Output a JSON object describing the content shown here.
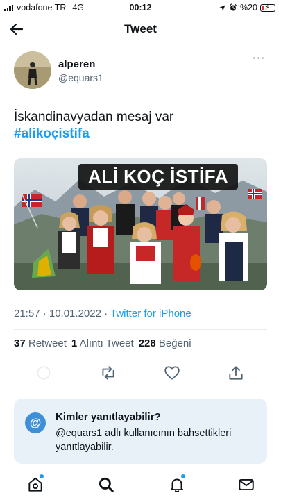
{
  "status_bar": {
    "carrier": "vodafone TR",
    "network": "4G",
    "time": "00:12",
    "battery_percent": "%20",
    "battery_level": 0.2
  },
  "header": {
    "title": "Tweet"
  },
  "tweet": {
    "user_name": "alperen",
    "user_handle": "@equars1",
    "text": "İskandinavyadan mesaj var",
    "hashtag": "#alikoçistifa",
    "media_caption": "ALİ KOÇ İSTİFA",
    "time": "21:57 · 10.01.2022 ·",
    "source": "Twitter for iPhone"
  },
  "stats": {
    "retweets_count": "37",
    "retweets_label": "Retweet",
    "quotes_count": "1",
    "quotes_label": "Alıntı Tweet",
    "likes_count": "228",
    "likes_label": "Beğeni"
  },
  "reply_info": {
    "icon_glyph": "@",
    "title": "Kimler yanıtlayabilir?",
    "description": "@equars1 adlı kullanıcının bahsettikleri yanıtlayabilir."
  },
  "colors": {
    "accent": "#1d9bf0",
    "secondary_text": "#536471",
    "card_background": "#e8f1f8"
  },
  "icons": {
    "back": "arrow-left-icon",
    "more": "more-icon",
    "reply": "reply-icon",
    "retweet": "retweet-icon",
    "like": "heart-icon",
    "share": "share-icon",
    "home": "home-icon",
    "search": "search-icon",
    "notifications": "bell-icon",
    "messages": "mail-icon"
  }
}
